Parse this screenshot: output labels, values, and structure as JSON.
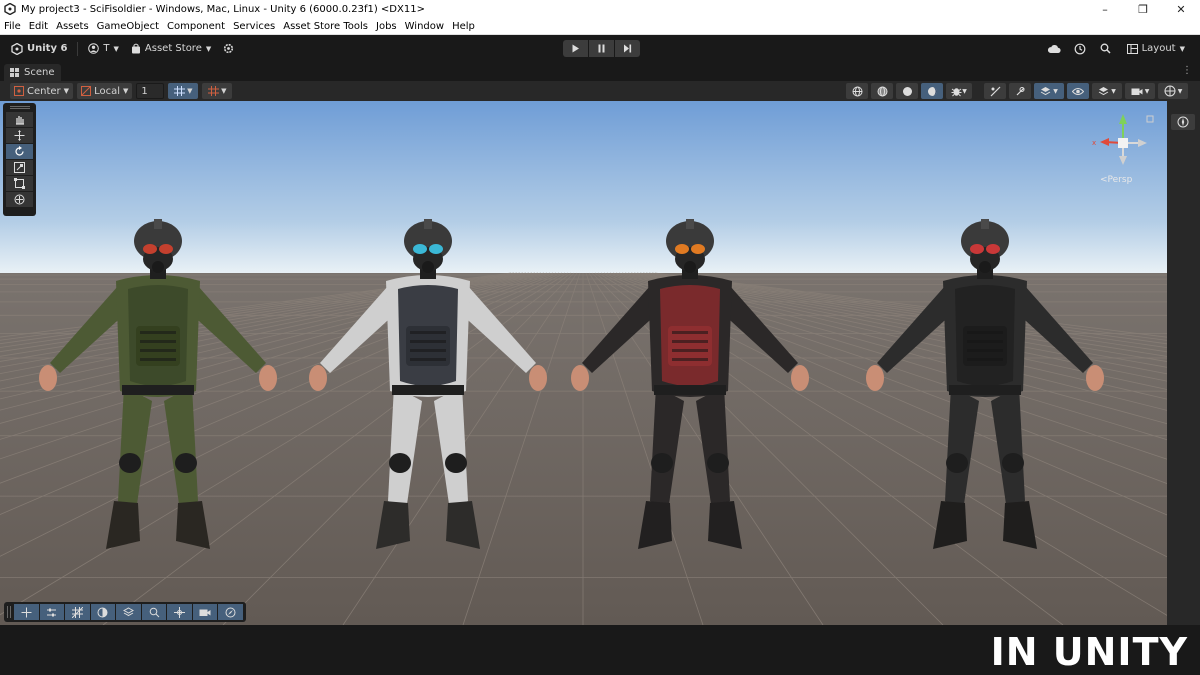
{
  "window": {
    "title": "My project3 - SciFisoldier - Windows, Mac, Linux - Unity 6 (6000.0.23f1) <DX11>",
    "controls": [
      "–",
      "❐",
      "✕"
    ]
  },
  "menu": [
    "File",
    "Edit",
    "Assets",
    "GameObject",
    "Component",
    "Services",
    "Asset Store Tools",
    "Jobs",
    "Window",
    "Help"
  ],
  "toolbar": {
    "unity_label": "Unity 6",
    "account_label": "T",
    "asset_store_label": "Asset Store",
    "layout_label": "Layout"
  },
  "tabs": {
    "scene_label": "Scene"
  },
  "scene_toolbar": {
    "pivot_label": "Center",
    "space_label": "Local",
    "grid_value": "1"
  },
  "viewport": {
    "persp_label": "<Persp",
    "sky_top_color": "#6f9dd6",
    "sky_horizon_color": "#e9f1f6",
    "ground_color": "#6e655f",
    "grid_color": "#8a8078",
    "soldiers": [
      {
        "name": "soldier-olive",
        "suit": "#4d5a34",
        "armor": "#3d4a2a",
        "accent": "#34401f",
        "goggle": "#c4402e",
        "boots": "#2a2722"
      },
      {
        "name": "soldier-white",
        "suit": "#cfcfcf",
        "armor": "#3a3d44",
        "accent": "#2d3036",
        "goggle": "#3bb8d6",
        "boots": "#2d2c2a"
      },
      {
        "name": "soldier-red",
        "suit": "#2b2828",
        "armor": "#7a2a2c",
        "accent": "#8e2e30",
        "goggle": "#e07a22",
        "boots": "#222020"
      },
      {
        "name": "soldier-black",
        "suit": "#2c2c2c",
        "armor": "#222222",
        "accent": "#1c1c1c",
        "goggle": "#c93838",
        "boots": "#1f1e1d"
      }
    ]
  },
  "watermark": "IN UNITY",
  "accent_color": "#46607c"
}
